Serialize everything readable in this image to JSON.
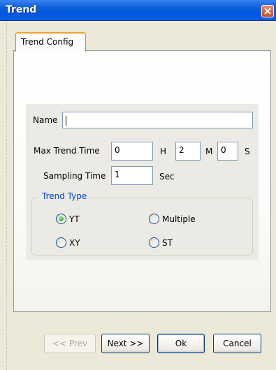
{
  "window": {
    "title": "Trend"
  },
  "tabs": [
    {
      "label": "Trend Config"
    }
  ],
  "form": {
    "name": {
      "label": "Name",
      "value": ""
    },
    "max_trend_time": {
      "label": "Max Trend Time",
      "hours": "0",
      "hours_unit": "H",
      "minutes": "2",
      "minutes_unit": "M",
      "seconds": "0",
      "seconds_unit": "S"
    },
    "sampling_time": {
      "label": "Sampling Time",
      "value": "1",
      "unit": "Sec"
    },
    "trend_type": {
      "label": "Trend Type",
      "options": [
        {
          "label": "YT",
          "selected": true
        },
        {
          "label": "Multiple",
          "selected": false
        },
        {
          "label": "XY",
          "selected": false
        },
        {
          "label": "ST",
          "selected": false
        }
      ]
    }
  },
  "buttons": {
    "prev": "<< Prev",
    "next": "Next >>",
    "ok": "Ok",
    "cancel": "Cancel"
  }
}
